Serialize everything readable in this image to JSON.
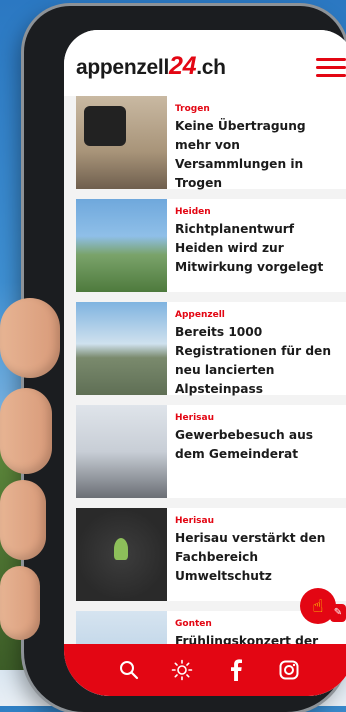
{
  "header": {
    "logo_text_a": "appenzell",
    "logo_text_num": "24",
    "logo_text_b": ".ch",
    "menu_icon": "hamburger-menu-icon"
  },
  "articles": [
    {
      "location": "Trogen",
      "title": "Keine Übertragung mehr von Versammlungen in Trogen"
    },
    {
      "location": "Heiden",
      "title": "Richtplanentwurf Heiden wird zur Mitwirkung vorgelegt"
    },
    {
      "location": "Appenzell",
      "title": "Bereits 1000 Registrationen für den neu lancierten Alpsteinpass"
    },
    {
      "location": "Herisau",
      "title": "Gewerbebesuch aus dem Gemeinderat"
    },
    {
      "location": "Herisau",
      "title": "Herisau verstärkt den Fachbereich Umweltschutz"
    },
    {
      "location": "Gonten",
      "title": "Frühlingskonzert der"
    }
  ],
  "bottom_nav": {
    "items": [
      "search-icon",
      "sun-icon",
      "facebook-icon",
      "instagram-icon"
    ]
  },
  "colors": {
    "accent": "#e30613",
    "fab_thumb": "#ffd400"
  }
}
